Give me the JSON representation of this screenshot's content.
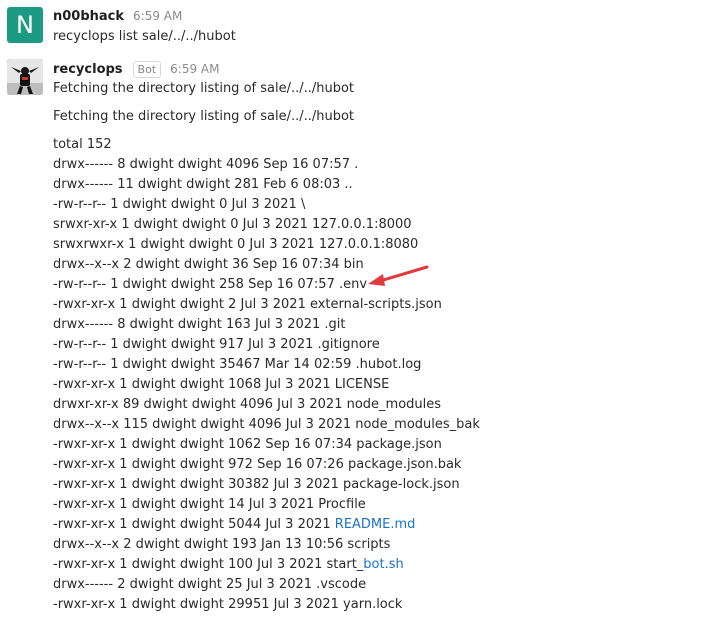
{
  "messages": [
    {
      "avatar_letter": "N",
      "username": "n00bhack",
      "timestamp": "6:59 AM",
      "text": "recyclops list sale/../../hubot"
    },
    {
      "username": "recyclops",
      "badge": "Bot",
      "timestamp": "6:59 AM",
      "line1": "Fetching the directory listing of sale/../../hubot",
      "line2": "Fetching the directory listing of sale/../../hubot",
      "listing": [
        {
          "text": "total 152"
        },
        {
          "text": "drwx------ 8 dwight dwight 4096 Sep 16 07:57 ."
        },
        {
          "text": "drwx------ 11 dwight dwight 281 Feb 6 08:03 .."
        },
        {
          "text": "-rw-r--r-- 1 dwight dwight 0 Jul 3 2021 \\"
        },
        {
          "text": "srwxr-xr-x 1 dwight dwight 0 Jul 3 2021 127.0.0.1:8000"
        },
        {
          "text": "srwxrwxr-x 1 dwight dwight 0 Jul 3 2021 127.0.0.1:8080"
        },
        {
          "text": "drwx--x--x 2 dwight dwight 36 Sep 16 07:34 bin"
        },
        {
          "text": "-rw-r--r-- 1 dwight dwight 258 Sep 16 07:57 .env"
        },
        {
          "text": "-rwxr-xr-x 1 dwight dwight 2 Jul 3 2021 external-scripts.json"
        },
        {
          "text": "drwx------ 8 dwight dwight 163 Jul 3 2021 .git"
        },
        {
          "text": "-rw-r--r-- 1 dwight dwight 917 Jul 3 2021 .gitignore"
        },
        {
          "text": "-rw-r--r-- 1 dwight dwight 35467 Mar 14 02:59 .hubot.log"
        },
        {
          "text": "-rwxr-xr-x 1 dwight dwight 1068 Jul 3 2021 LICENSE"
        },
        {
          "text": "drwxr-xr-x 89 dwight dwight 4096 Jul 3 2021 node_modules"
        },
        {
          "text": "drwx--x--x 115 dwight dwight 4096 Jul 3 2021 node_modules_bak"
        },
        {
          "text": "-rwxr-xr-x 1 dwight dwight 1062 Sep 16 07:34 package.json"
        },
        {
          "text": "-rwxr-xr-x 1 dwight dwight 972 Sep 16 07:26 package.json.bak"
        },
        {
          "text": "-rwxr-xr-x 1 dwight dwight 30382 Jul 3 2021 package-lock.json"
        },
        {
          "text": "-rwxr-xr-x 1 dwight dwight 14 Jul 3 2021 Procfile"
        },
        {
          "text": "-rwxr-xr-x 1 dwight dwight 5044 Jul 3 2021 ",
          "link": "README.md"
        },
        {
          "text": "drwx--x--x 2 dwight dwight 193 Jan 13 10:56 scripts"
        },
        {
          "text": "-rwxr-xr-x 1 dwight dwight 100 Jul 3 2021 start_",
          "link": "bot.sh"
        },
        {
          "text": "drwx------ 2 dwight dwight 25 Jul 3 2021 .vscode"
        },
        {
          "text": "-rwxr-xr-x 1 dwight dwight 29951 Jul 3 2021 yarn.lock"
        }
      ]
    }
  ],
  "colors": {
    "link": "#1a73c8",
    "avatar_bg": "#1d9a84",
    "arrow": "#e0393e"
  }
}
